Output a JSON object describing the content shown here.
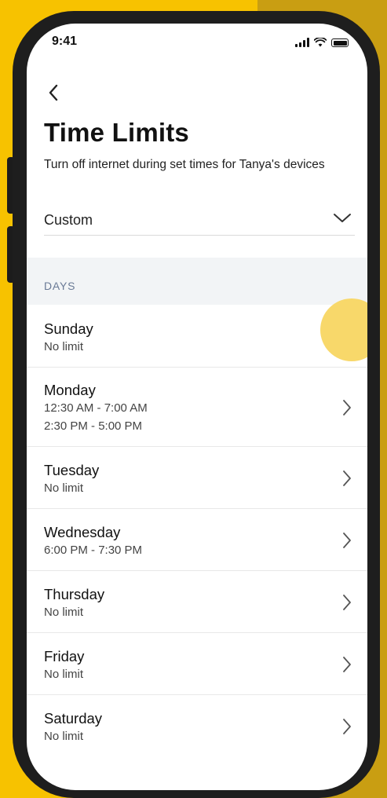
{
  "status_bar": {
    "time": "9:41"
  },
  "header": {
    "back_icon": "chevron-left-icon",
    "title": "Time Limits",
    "subtitle": "Turn off internet during set times for Tanya's devices"
  },
  "schedule": {
    "selected": "Custom",
    "icon": "chevron-down-icon"
  },
  "days_section": {
    "label": "DAYS",
    "items": [
      {
        "name": "Sunday",
        "detail_1": "No limit",
        "detail_2": ""
      },
      {
        "name": "Monday",
        "detail_1": "12:30 AM - 7:00 AM",
        "detail_2": "2:30 PM - 5:00 PM"
      },
      {
        "name": "Tuesday",
        "detail_1": "No limit",
        "detail_2": ""
      },
      {
        "name": "Wednesday",
        "detail_1": "6:00 PM - 7:30 PM",
        "detail_2": ""
      },
      {
        "name": "Thursday",
        "detail_1": "No limit",
        "detail_2": ""
      },
      {
        "name": "Friday",
        "detail_1": "No limit",
        "detail_2": ""
      },
      {
        "name": "Saturday",
        "detail_1": "No limit",
        "detail_2": ""
      }
    ]
  },
  "colors": {
    "background": "#F7C200",
    "background_shade": "#C99E12",
    "touch_indicator": "#F8D86A",
    "section_header_bg": "#f2f4f6",
    "section_label": "#6a7a96"
  }
}
